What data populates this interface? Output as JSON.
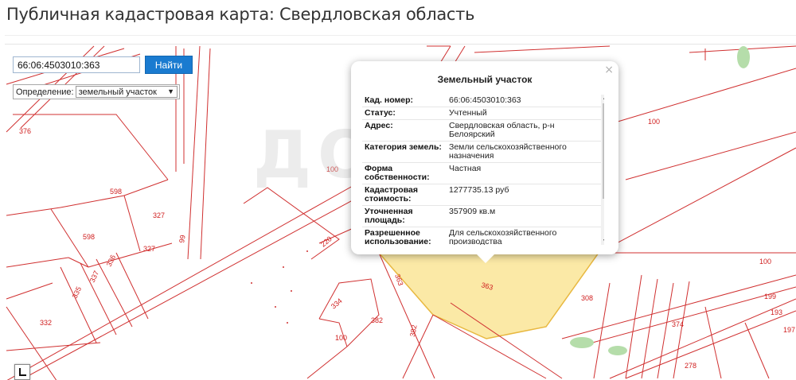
{
  "page": {
    "title": "Публичная кадастровая карта: Свердловская область"
  },
  "search": {
    "value": "66:06:4503010:363",
    "button_label": "Найти"
  },
  "definition": {
    "label": "Определение:",
    "selected": "земельный участок"
  },
  "popup": {
    "title": "Земельный участок",
    "close_glyph": "×",
    "rows": [
      {
        "key": "Кад. номер:",
        "value": "66:06:4503010:363"
      },
      {
        "key": "Статус:",
        "value": "Учтенный"
      },
      {
        "key": "Адрес:",
        "value": "Свердловская область, р-н Белоярский"
      },
      {
        "key": "Категория земель:",
        "value": "Земли сельскохозяйственного назначения"
      },
      {
        "key": "Форма собственности:",
        "value": "Частная"
      },
      {
        "key": "Кадастровая стоимость:",
        "value": "1277735.13 руб"
      },
      {
        "key": "Уточненная площадь:",
        "value": "357909 кв.м"
      },
      {
        "key": "Разрешенное использование:",
        "value": "Для сельскохозяйственного производства"
      }
    ]
  },
  "map": {
    "watermark": "ДОМ С",
    "parcel_labels": [
      "376",
      "598",
      "327",
      "598",
      "336",
      "327",
      "337",
      "335",
      "332",
      "99",
      "100",
      "220",
      "334",
      "382",
      "382",
      "100",
      "363",
      "363",
      "308",
      "374",
      "100",
      "100",
      "199",
      "193",
      "197",
      "278"
    ],
    "colors": {
      "boundary": "#d03030",
      "selected_fill": "#fbe9a6",
      "selected_stroke": "#e8b840",
      "road": "#d03030"
    }
  }
}
